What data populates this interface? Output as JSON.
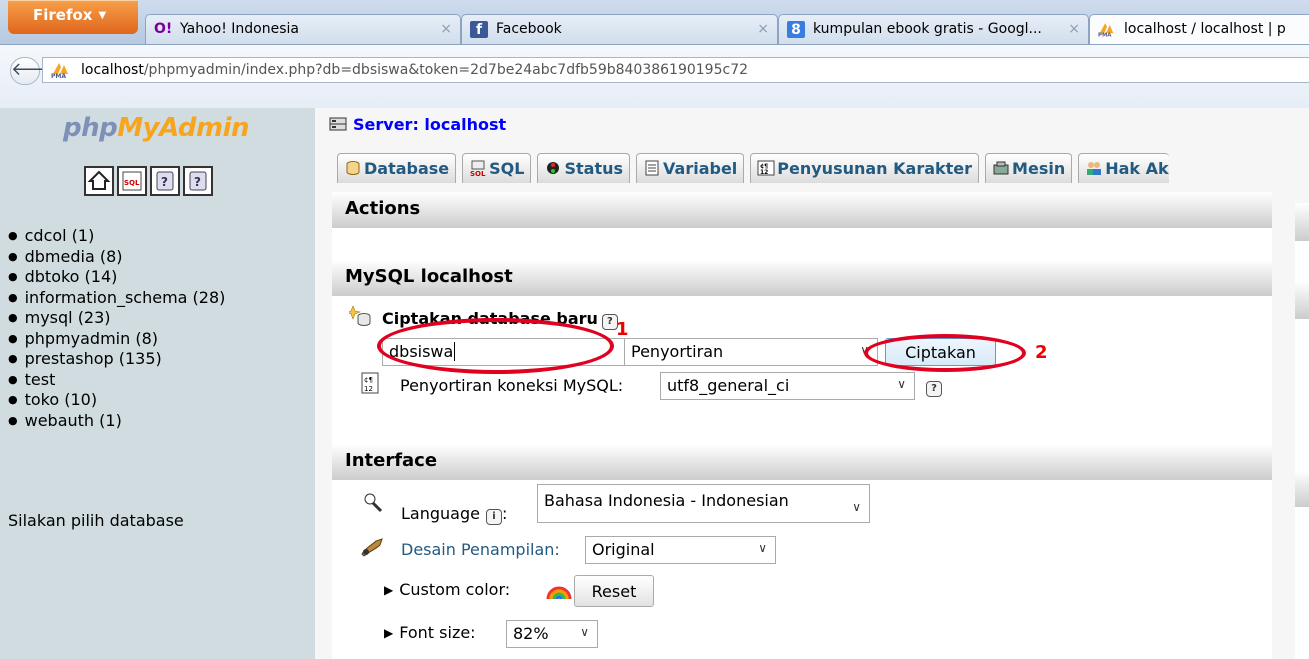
{
  "browser": {
    "menu_button": "Firefox",
    "tabs": [
      {
        "title": "Yahoo! Indonesia",
        "active": false
      },
      {
        "title": "Facebook",
        "active": false
      },
      {
        "title": "kumpulan ebook gratis - Googl...",
        "active": false
      },
      {
        "title": "localhost / localhost | p",
        "active": true
      }
    ],
    "close_glyph": "×",
    "url_host": "localhost",
    "url_path": "/phpmyadmin/index.php?db=dbsiswa&token=2d7be24abc7dfb59b840386190195c72"
  },
  "left": {
    "logo_php": "php",
    "logo_my": "My",
    "logo_admin": "Admin",
    "icons": [
      "home-icon",
      "sql-query-icon",
      "help-docs-icon",
      "mysql-docs-icon"
    ],
    "databases": [
      "cdcol (1)",
      "dbmedia (8)",
      "dbtoko (14)",
      "information_schema (28)",
      "mysql (23)",
      "phpmyadmin (8)",
      "prestashop (135)",
      "test",
      "toko (10)",
      "webauth (1)"
    ],
    "select_prompt": "Silakan pilih database"
  },
  "main": {
    "server_label": "Server: localhost",
    "menu_tabs": [
      {
        "label": "Database",
        "icon": "database-icon"
      },
      {
        "label": "SQL",
        "icon": "sql-icon"
      },
      {
        "label": "Status",
        "icon": "status-icon"
      },
      {
        "label": "Variabel",
        "icon": "variables-icon"
      },
      {
        "label": "Penyusunan Karakter",
        "icon": "charset-icon"
      },
      {
        "label": "Mesin",
        "icon": "engines-icon"
      },
      {
        "label": "Hak Ak",
        "icon": "privileges-icon"
      }
    ],
    "actions_heading": "Actions",
    "mysql_heading": "MySQL localhost",
    "create_db": {
      "title": "Ciptakan database baru",
      "name_value": "dbsiswa",
      "collation_value": "Penyortiran",
      "submit_label": "Ciptakan"
    },
    "connection_collation": {
      "label": "Penyortiran koneksi MySQL:",
      "value": "utf8_general_ci"
    },
    "interface_heading": "Interface",
    "language": {
      "label": "Language",
      "value": "Bahasa Indonesia - Indonesian"
    },
    "theme": {
      "label": "Desain Penampilan:",
      "value": "Original"
    },
    "custom_color": {
      "label": "Custom color:",
      "reset_label": "Reset"
    },
    "font_size": {
      "label": "Font size:",
      "value": "82%"
    }
  },
  "annotations": {
    "marker_1": "1",
    "marker_2": "2",
    "color": "#e00020"
  }
}
